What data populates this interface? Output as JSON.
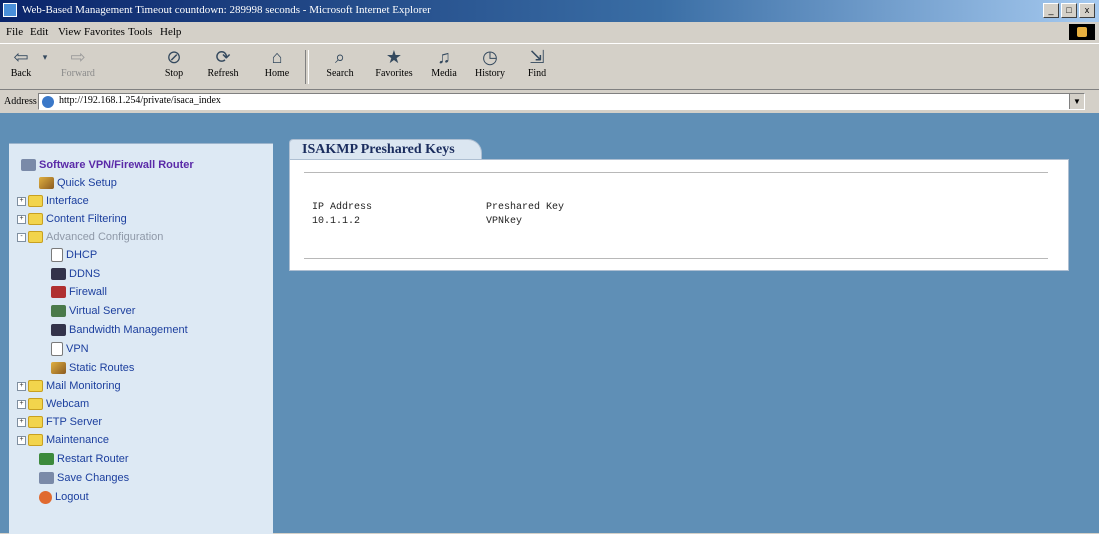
{
  "window": {
    "title": "Web-Based Management Timeout countdown: 289998 seconds - Microsoft Internet Explorer",
    "controls": [
      "_",
      "□",
      "x"
    ]
  },
  "menu": [
    "File",
    "Edit",
    "View",
    "Favorites",
    "Tools",
    "Help"
  ],
  "toolbar": [
    {
      "label": "Back",
      "icon": "back-arrow",
      "disabled": false
    },
    {
      "label": "Forward",
      "icon": "forward-arrow",
      "disabled": true
    },
    {
      "label": "Stop",
      "icon": "stop",
      "disabled": false
    },
    {
      "label": "Refresh",
      "icon": "refresh",
      "disabled": false
    },
    {
      "label": "Home",
      "icon": "home",
      "disabled": false
    },
    {
      "label": "Search",
      "icon": "search",
      "disabled": false
    },
    {
      "label": "Favorites",
      "icon": "favorites",
      "disabled": false
    },
    {
      "label": "Media",
      "icon": "media",
      "disabled": false
    },
    {
      "label": "History",
      "icon": "history",
      "disabled": false
    },
    {
      "label": "Find",
      "icon": "find",
      "disabled": false
    }
  ],
  "address": {
    "label": "Address",
    "url": "http://192.168.1.254/private/isaca_index"
  },
  "sidebar": {
    "root": "Software VPN/Firewall Router",
    "items": [
      {
        "label": "Quick Setup",
        "icon": "wizard-icon",
        "level": 1,
        "expander": ""
      },
      {
        "label": "Interface",
        "icon": "folder-icon",
        "level": 0,
        "expander": "+"
      },
      {
        "label": "Content Filtering",
        "icon": "folder-icon",
        "level": 0,
        "expander": "+"
      },
      {
        "label": "Advanced Configuration",
        "icon": "folder-open-icon",
        "level": 0,
        "expander": "-",
        "disabled": true
      },
      {
        "label": "DHCP",
        "icon": "page-icon",
        "level": 2,
        "expander": ""
      },
      {
        "label": "DDNS",
        "icon": "ddns-icon",
        "level": 2,
        "expander": ""
      },
      {
        "label": "Firewall",
        "icon": "firewall-icon",
        "level": 2,
        "expander": ""
      },
      {
        "label": "Virtual Server",
        "icon": "server-icon",
        "level": 2,
        "expander": ""
      },
      {
        "label": "Bandwidth Management",
        "icon": "bandwidth-icon",
        "level": 2,
        "expander": ""
      },
      {
        "label": "VPN",
        "icon": "page-icon",
        "level": 2,
        "expander": ""
      },
      {
        "label": "Static Routes",
        "icon": "routes-icon",
        "level": 2,
        "expander": ""
      },
      {
        "label": "Mail Monitoring",
        "icon": "folder-icon",
        "level": 0,
        "expander": "+"
      },
      {
        "label": "Webcam",
        "icon": "folder-icon",
        "level": 0,
        "expander": "+"
      },
      {
        "label": "FTP Server",
        "icon": "folder-icon",
        "level": 0,
        "expander": "+"
      },
      {
        "label": "Maintenance",
        "icon": "folder-icon",
        "level": 0,
        "expander": "+"
      },
      {
        "label": "Restart Router",
        "icon": "restart-icon",
        "level": 1,
        "expander": ""
      },
      {
        "label": "Save Changes",
        "icon": "save-icon",
        "level": 1,
        "expander": ""
      },
      {
        "label": "Logout",
        "icon": "logout-icon",
        "level": 1,
        "expander": ""
      }
    ]
  },
  "main": {
    "tab_title": "ISAKMP Preshared Keys",
    "columns": [
      "IP Address",
      "Preshared Key"
    ],
    "rows": [
      [
        "10.1.1.2",
        "VPNkey"
      ]
    ]
  }
}
